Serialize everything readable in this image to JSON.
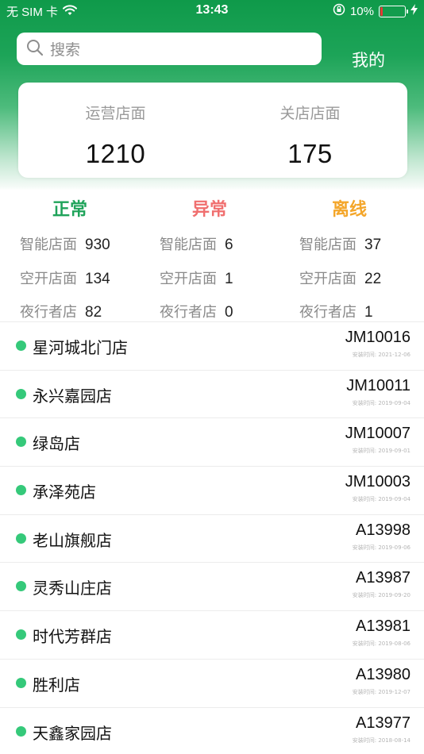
{
  "status_bar": {
    "carrier": "无 SIM 卡",
    "time": "13:43",
    "battery": "10%",
    "battery_level": 0.1,
    "icons": [
      "wifi-icon",
      "orientation-lock-icon",
      "battery-icon",
      "charging-icon"
    ]
  },
  "header": {
    "search_placeholder": "搜索",
    "mine_label": "我的"
  },
  "summary": {
    "operating_label": "运营店面",
    "operating_value": "1210",
    "closed_label": "关店店面",
    "closed_value": "175"
  },
  "categories": [
    {
      "title": "正常",
      "color": "#1fa35a",
      "stats": [
        {
          "label": "智能店面",
          "value": "930"
        },
        {
          "label": "空开店面",
          "value": "134"
        },
        {
          "label": "夜行者店",
          "value": "82"
        }
      ]
    },
    {
      "title": "异常",
      "color": "#f06f6f",
      "stats": [
        {
          "label": "智能店面",
          "value": "6"
        },
        {
          "label": "空开店面",
          "value": "1"
        },
        {
          "label": "夜行者店",
          "value": "0"
        }
      ]
    },
    {
      "title": "离线",
      "color": "#f4a62a",
      "stats": [
        {
          "label": "智能店面",
          "value": "37"
        },
        {
          "label": "空开店面",
          "value": "22"
        },
        {
          "label": "夜行者店",
          "value": "1"
        }
      ]
    }
  ],
  "stores": [
    {
      "name": "星河城北门店",
      "code": "JM10016",
      "install": "安装时间: 2021-12-06"
    },
    {
      "name": "永兴嘉园店",
      "code": "JM10011",
      "install": "安装时间: 2019-09-04"
    },
    {
      "name": "绿岛店",
      "code": "JM10007",
      "install": "安装时间: 2019-09-01"
    },
    {
      "name": "承泽苑店",
      "code": "JM10003",
      "install": "安装时间: 2019-09-04"
    },
    {
      "name": "老山旗舰店",
      "code": "A13998",
      "install": "安装时间: 2019-09-06"
    },
    {
      "name": "灵秀山庄店",
      "code": "A13987",
      "install": "安装时间: 2019-09-20"
    },
    {
      "name": "时代芳群店",
      "code": "A13981",
      "install": "安装时间: 2019-08-06"
    },
    {
      "name": "胜利店",
      "code": "A13980",
      "install": "安装时间: 2019-12-07"
    },
    {
      "name": "天鑫家园店",
      "code": "A13977",
      "install": "安装时间: 2018-08-14"
    }
  ],
  "colors": {
    "brand_green": "#1da458",
    "online_dot": "#35c97a"
  }
}
